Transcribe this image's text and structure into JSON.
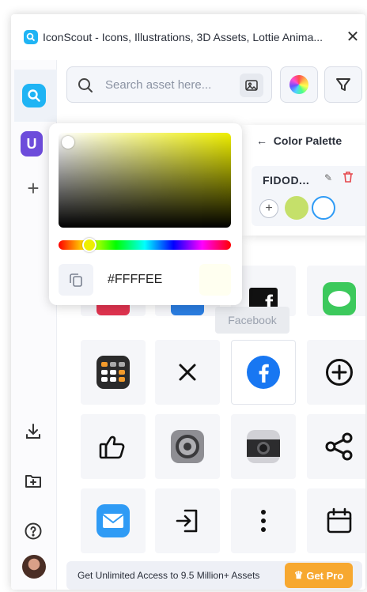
{
  "window": {
    "title": "IconScout - Icons, Illustrations, 3D Assets, Lottie Anima...",
    "close_label": "✕"
  },
  "search": {
    "placeholder": "Search asset here..."
  },
  "color_picker": {
    "hex_value": "#FFFFEE"
  },
  "color_palette": {
    "back_label": "Color Palette",
    "palette_name": "FIDOD...",
    "swatches": [
      "#c5e06a",
      "#ffffff"
    ]
  },
  "grid": {
    "tooltip": "Facebook",
    "icons": [
      "calculator-icon",
      "close-x-icon",
      "facebook-icon",
      "plus-circle-icon",
      "thumbs-up-icon",
      "ios-settings-icon",
      "camera-icon",
      "share-icon",
      "mail-icon",
      "sign-in-icon",
      "more-vertical-icon",
      "calendar-icon",
      "facebook-square-icon",
      "messages-icon"
    ]
  },
  "promo": {
    "text": "Get Unlimited Access to 9.5 Million+ Assets",
    "button_label": "Get Pro"
  },
  "colors": {
    "brand": "#1fb4f4",
    "accent_orange": "#f7a830",
    "u_badge": "#6d4cdb"
  }
}
